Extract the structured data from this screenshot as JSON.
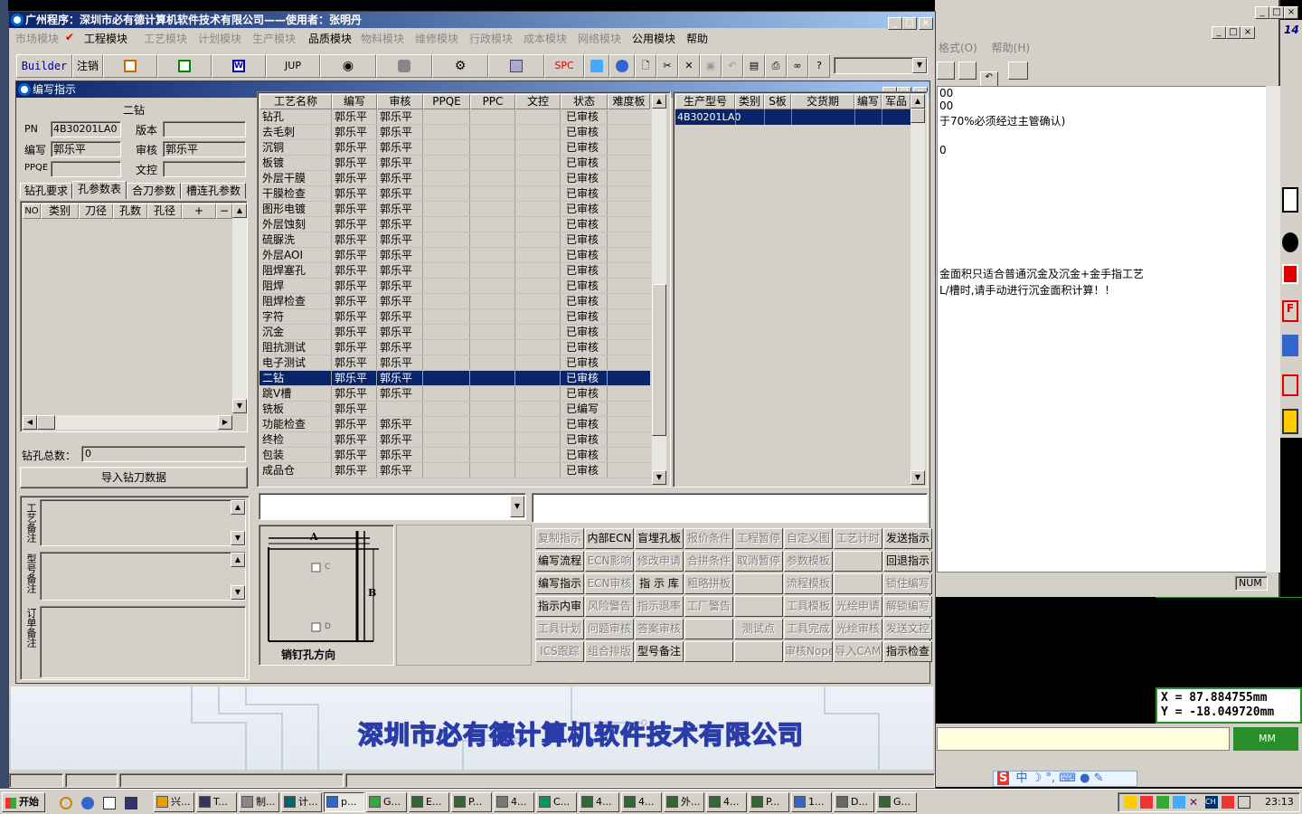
{
  "bg_window": {
    "menu": [
      "格式(O)",
      "帮助(H)"
    ],
    "text_lines": [
      "00",
      "于70%必须经过主管确认)",
      "0",
      "金面积只适合普通沉金及沉金+金手指工艺",
      "L/槽时,请手动进行沉金面积计算！！"
    ],
    "status": "NUM"
  },
  "coords": {
    "x": "X  = 87.884755mm",
    "y": "Y  = -18.049720mm",
    "unit": "MM",
    "scale_top": "14"
  },
  "main_window": {
    "title": "广州程序：深圳市必有德计算机软件技术有限公司——使用者：张明丹",
    "menu": [
      {
        "label": "市场模块",
        "dim": true
      },
      {
        "label": "工程模块",
        "dim": false,
        "checked": true
      },
      {
        "label": "工艺模块",
        "dim": true
      },
      {
        "label": "计划模块",
        "dim": true
      },
      {
        "label": "生产模块",
        "dim": true
      },
      {
        "label": "品质模块",
        "dim": false
      },
      {
        "label": "物料模块",
        "dim": true
      },
      {
        "label": "维修模块",
        "dim": true
      },
      {
        "label": "行政模块",
        "dim": true
      },
      {
        "label": "成本模块",
        "dim": true
      },
      {
        "label": "网络模块",
        "dim": true
      },
      {
        "label": "公用模块",
        "dim": false
      },
      {
        "label": "帮助",
        "dim": false
      }
    ],
    "toolbar": {
      "builder": "Builder",
      "cancel": "注销",
      "jup": "JUP",
      "spc": "SPC"
    },
    "company_banner": "深圳市必有德计算机软件技术有限公司"
  },
  "child_window": {
    "title": "编写指示"
  },
  "left_panel": {
    "header": "二钻",
    "pn_label": "PN",
    "pn_value": "4B30201LA0",
    "version_label": "版本",
    "version_value": "",
    "writer_label": "编写",
    "writer_value": "郭乐平",
    "reviewer_label": "审核",
    "reviewer_value": "郭乐平",
    "ppqe_label": "PPQE",
    "ppqe_value": "",
    "doc_label": "文控",
    "doc_value": "",
    "tabs": [
      "钻孔要求",
      "孔参数表",
      "合刀参数",
      "槽连孔参数"
    ],
    "grid_headers": [
      "NO",
      "类别",
      "刀径",
      "孔数",
      "孔径",
      "+",
      "−"
    ],
    "total_label": "钻孔总数：",
    "total_value": "0",
    "import_button": "导入钻刀数据",
    "note_labels": [
      "工艺备注",
      "型号备注",
      "订单备注"
    ]
  },
  "process_table": {
    "headers": [
      "工艺名称",
      "编写",
      "审核",
      "PPQE",
      "PPC",
      "文控",
      "状态",
      "难度板"
    ],
    "selected_index": 17,
    "rows": [
      [
        "钻孔",
        "郭乐平",
        "郭乐平",
        "已审核"
      ],
      [
        "去毛刺",
        "郭乐平",
        "郭乐平",
        "已审核"
      ],
      [
        "沉铜",
        "郭乐平",
        "郭乐平",
        "已审核"
      ],
      [
        "板镀",
        "郭乐平",
        "郭乐平",
        "已审核"
      ],
      [
        "外层干膜",
        "郭乐平",
        "郭乐平",
        "已审核"
      ],
      [
        "干膜检查",
        "郭乐平",
        "郭乐平",
        "已审核"
      ],
      [
        "图形电镀",
        "郭乐平",
        "郭乐平",
        "已审核"
      ],
      [
        "外层蚀刻",
        "郭乐平",
        "郭乐平",
        "已审核"
      ],
      [
        "硫脲洗",
        "郭乐平",
        "郭乐平",
        "已审核"
      ],
      [
        "外层AOI",
        "郭乐平",
        "郭乐平",
        "已审核"
      ],
      [
        "阻焊塞孔",
        "郭乐平",
        "郭乐平",
        "已审核"
      ],
      [
        "阻焊",
        "郭乐平",
        "郭乐平",
        "已审核"
      ],
      [
        "阻焊检查",
        "郭乐平",
        "郭乐平",
        "已审核"
      ],
      [
        "字符",
        "郭乐平",
        "郭乐平",
        "已审核"
      ],
      [
        "沉金",
        "郭乐平",
        "郭乐平",
        "已审核"
      ],
      [
        "阻抗测试",
        "郭乐平",
        "郭乐平",
        "已审核"
      ],
      [
        "电子测试",
        "郭乐平",
        "郭乐平",
        "已审核"
      ],
      [
        "二钻",
        "郭乐平",
        "郭乐平",
        "已审核"
      ],
      [
        "跳V槽",
        "郭乐平",
        "郭乐平",
        "已审核"
      ],
      [
        "铣板",
        "郭乐平",
        "",
        "已编写"
      ],
      [
        "功能检查",
        "郭乐平",
        "郭乐平",
        "已审核"
      ],
      [
        "终检",
        "郭乐平",
        "郭乐平",
        "已审核"
      ],
      [
        "包装",
        "郭乐平",
        "郭乐平",
        "已审核"
      ],
      [
        "成品仓",
        "郭乐平",
        "郭乐平",
        "已审核"
      ]
    ]
  },
  "model_table": {
    "headers": [
      "生产型号",
      "类别",
      "S板",
      "交货期",
      "编写",
      "军品"
    ],
    "rows": [
      [
        "4B30201LA0",
        "",
        "",
        "",
        "",
        ""
      ]
    ]
  },
  "diagram": {
    "label_a": "A",
    "label_b": "B",
    "label_c": "C",
    "label_d": "D",
    "caption": "销钉孔方向"
  },
  "action_buttons": [
    [
      {
        "t": "复制指示",
        "d": true
      },
      {
        "t": "内部ECN",
        "d": false
      },
      {
        "t": "盲埋孔板",
        "d": false
      },
      {
        "t": "报价条件",
        "d": true
      },
      {
        "t": "工程暂停",
        "d": true
      },
      {
        "t": "自定义图",
        "d": true
      },
      {
        "t": "工艺计时",
        "d": true
      },
      {
        "t": "发送指示",
        "d": false
      }
    ],
    [
      {
        "t": "编写流程",
        "d": false
      },
      {
        "t": "ECN影响",
        "d": true
      },
      {
        "t": "修改申请",
        "d": true
      },
      {
        "t": "合拼条件",
        "d": true
      },
      {
        "t": "取消暂停",
        "d": true
      },
      {
        "t": "参数模板",
        "d": true
      },
      {
        "t": "",
        "d": true
      },
      {
        "t": "回退指示",
        "d": false
      }
    ],
    [
      {
        "t": "编写指示",
        "d": false
      },
      {
        "t": "ECN审核",
        "d": true
      },
      {
        "t": "指 示 库",
        "d": false
      },
      {
        "t": "粗略拼板",
        "d": true
      },
      {
        "t": "",
        "d": true
      },
      {
        "t": "流程模板",
        "d": true
      },
      {
        "t": "",
        "d": true
      },
      {
        "t": "锁住编写",
        "d": true
      }
    ],
    [
      {
        "t": "指示内审",
        "d": false
      },
      {
        "t": "风险警告",
        "d": true
      },
      {
        "t": "指示退率",
        "d": true
      },
      {
        "t": "工厂警告",
        "d": true
      },
      {
        "t": "",
        "d": true
      },
      {
        "t": "工具模板",
        "d": true
      },
      {
        "t": "光绘申请",
        "d": true
      },
      {
        "t": "解锁编写",
        "d": true
      }
    ],
    [
      {
        "t": "工具计划",
        "d": true
      },
      {
        "t": "问题审核",
        "d": true
      },
      {
        "t": "答案审核",
        "d": true
      },
      {
        "t": "",
        "d": true
      },
      {
        "t": "测试点",
        "d": true
      },
      {
        "t": "工具完成",
        "d": true
      },
      {
        "t": "光绘审核",
        "d": true
      },
      {
        "t": "发送文控",
        "d": true
      }
    ],
    [
      {
        "t": "ICS跟踪",
        "d": true
      },
      {
        "t": "组合排版",
        "d": true
      },
      {
        "t": "型号备注",
        "d": false
      },
      {
        "t": "",
        "d": true
      },
      {
        "t": "",
        "d": true
      },
      {
        "t": "审核Nope",
        "d": true
      },
      {
        "t": "导入CAM",
        "d": true
      },
      {
        "t": "指示检查",
        "d": false
      }
    ]
  ],
  "taskbar": {
    "start": "开始",
    "tasks": [
      "兴...",
      "T...",
      "制...",
      "计...",
      "p...",
      "G...",
      "E...",
      "P...",
      "4...",
      "C...",
      "4...",
      "4...",
      "外...",
      "4...",
      "P...",
      "1...",
      "D...",
      "G..."
    ],
    "clock": "23:13",
    "ime": "中"
  }
}
